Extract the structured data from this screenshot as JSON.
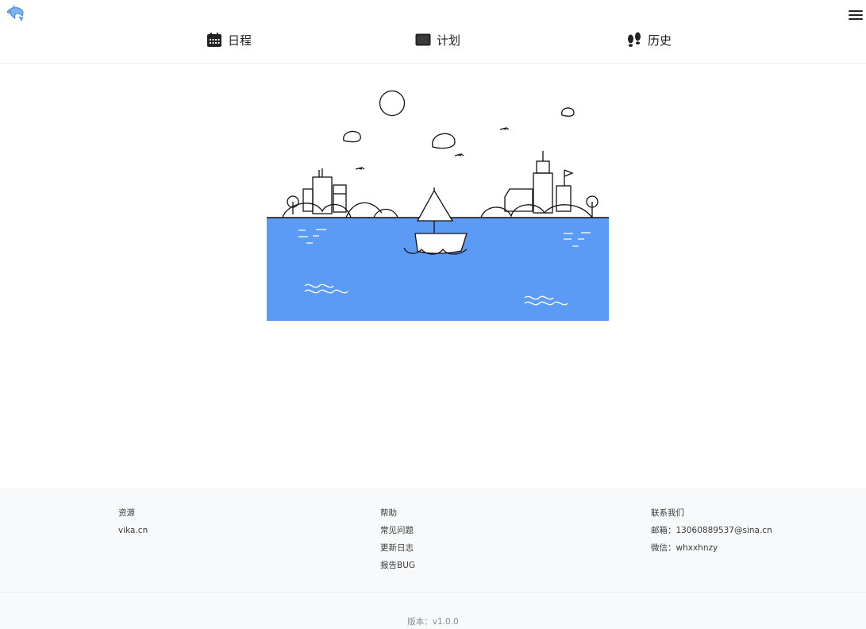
{
  "header": {
    "logo_icon": "dolphin-icon",
    "menu_icon": "hamburger-menu-icon",
    "nav": [
      {
        "label": "日程",
        "icon": "calendar-icon"
      },
      {
        "label": "计划",
        "icon": "tablet-icon"
      },
      {
        "label": "历史",
        "icon": "footprints-icon"
      }
    ]
  },
  "hero": {
    "illustration": "sailboat-harbor-illustration",
    "sea_color": "#5b9bf5"
  },
  "footer": {
    "resources": {
      "title": "资源",
      "items": [
        "vika.cn"
      ]
    },
    "help": {
      "title": "帮助",
      "items": [
        "常见问题",
        "更新日志",
        "报告BUG"
      ]
    },
    "contact": {
      "title": "联系我们",
      "email": "邮箱：13060889537@sina.cn",
      "wechat": "微信：whxxhnzy"
    },
    "version": "版本：v1.0.0"
  }
}
